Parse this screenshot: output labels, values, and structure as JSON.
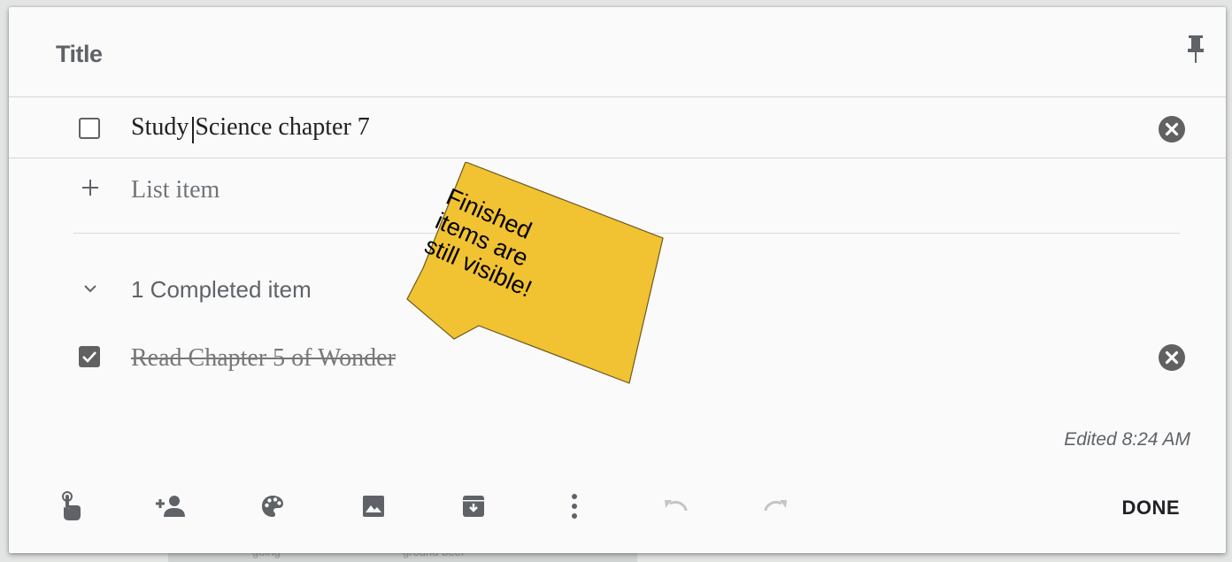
{
  "note": {
    "title": "Title",
    "items": [
      {
        "text": "Study Science chapter 7",
        "checked": false
      }
    ],
    "add_placeholder": "List item",
    "completed_section": {
      "label": "1 Completed item",
      "items": [
        {
          "text": "Read Chapter 5 of Wonder",
          "checked": true
        }
      ]
    },
    "edited": "Edited 8:24 AM"
  },
  "toolbar": {
    "icons": [
      "reminder-icon",
      "collaborator-icon",
      "palette-icon",
      "image-icon",
      "archive-icon",
      "more-icon",
      "undo-icon",
      "redo-icon"
    ],
    "done_label": "DONE"
  },
  "annotation": {
    "lines": [
      "Finished",
      "items are",
      "still visible!"
    ],
    "color": "#f1c232"
  },
  "background": {
    "labels": [
      "going",
      "ground beef"
    ]
  },
  "colors": {
    "icon": "#5f6368",
    "card": "#fafafa"
  }
}
